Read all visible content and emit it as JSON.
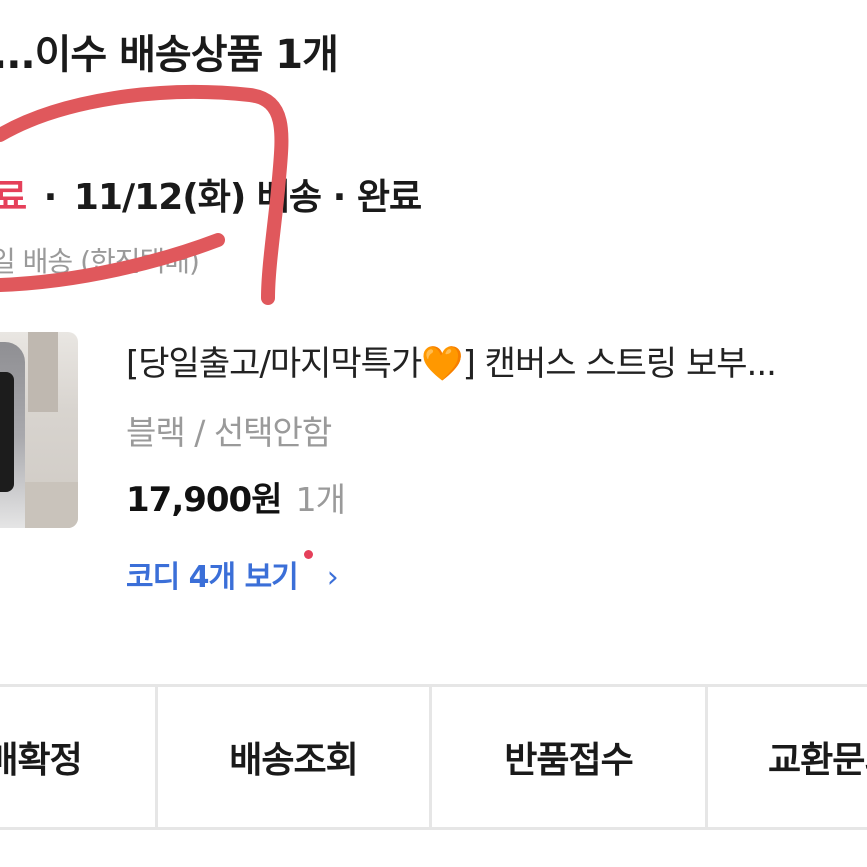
{
  "order": {
    "seller_title": "...이수 배송상품 1개",
    "status_red": "료",
    "status_dot": "·",
    "delivery_date": "11/12(화) 배송",
    "status_done": "· 완료",
    "shipping_method": "일 배송 (한진택배)"
  },
  "product": {
    "name": "[당일출고/마지막특가",
    "name_emoji": "🧡",
    "name_rest": "] 캔버스 스트링 보부...",
    "option": "블랙 / 선택안함",
    "price": "17,900원",
    "quantity": "1개",
    "coordi_link": "코디 4개 보기",
    "coordi_chevron": "›"
  },
  "actions": [
    {
      "label": "구매확정"
    },
    {
      "label": "배송조회"
    },
    {
      "label": "반품접수"
    },
    {
      "label": "교환문의"
    }
  ],
  "colors": {
    "status_red": "#e5405a",
    "link_blue": "#3b6fd8",
    "scribble_red": "#e0585c"
  }
}
